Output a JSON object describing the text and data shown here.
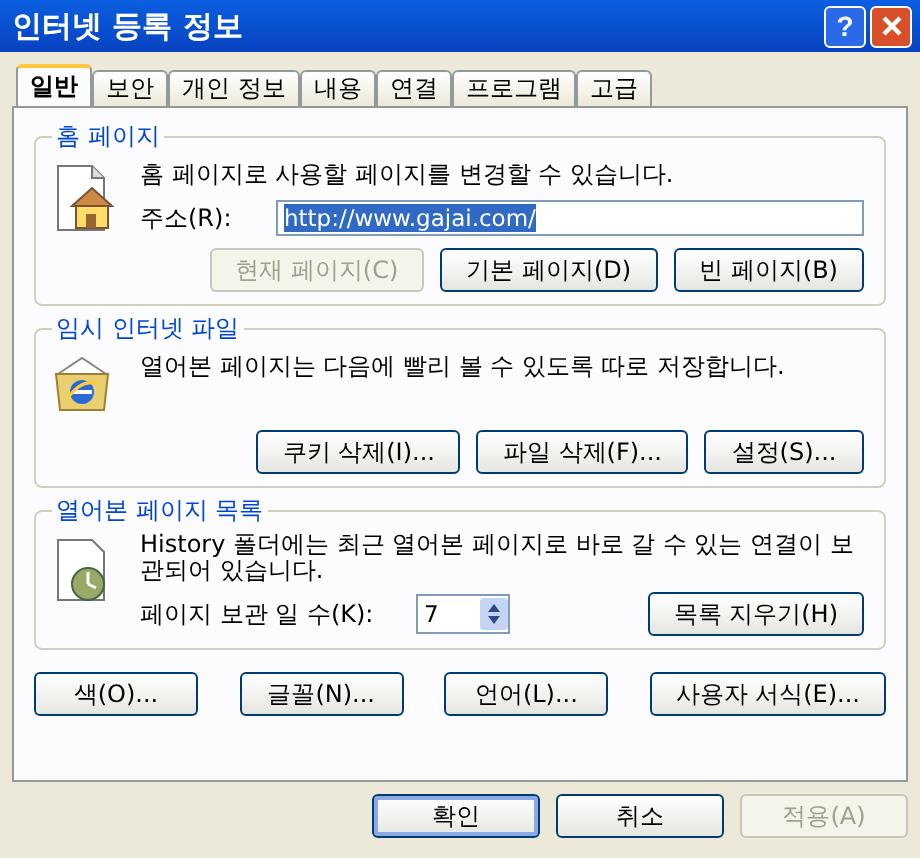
{
  "window": {
    "title": "인터넷 등록 정보",
    "help_glyph": "?"
  },
  "tabs": [
    {
      "label": "일반",
      "selected": true
    },
    {
      "label": "보안",
      "selected": false
    },
    {
      "label": "개인 정보",
      "selected": false
    },
    {
      "label": "내용",
      "selected": false
    },
    {
      "label": "연결",
      "selected": false
    },
    {
      "label": "프로그램",
      "selected": false
    },
    {
      "label": "고급",
      "selected": false
    }
  ],
  "home_page": {
    "title": "홈 페이지",
    "description": "홈 페이지로 사용할 페이지를 변경할 수 있습니다.",
    "address_label": "주소(R):",
    "address_value": "http://www.gajai.com/",
    "address_selected": true,
    "buttons": [
      {
        "label": "현재 페이지(C)",
        "disabled": true
      },
      {
        "label": "기본 페이지(D)",
        "disabled": false
      },
      {
        "label": "빈 페이지(B)",
        "disabled": false
      }
    ]
  },
  "temp_files": {
    "title": "임시 인터넷 파일",
    "description": "열어본 페이지는 다음에 빨리 볼 수 있도록 따로 저장합니다.",
    "buttons": [
      {
        "label": "쿠키 삭제(I)...",
        "disabled": false
      },
      {
        "label": "파일 삭제(F)...",
        "disabled": false
      },
      {
        "label": "설정(S)...",
        "disabled": false
      }
    ]
  },
  "history": {
    "title": "열어본 페이지 목록",
    "description": "History 폴더에는 최근 열어본 페이지로 바로 갈 수 있는 연결이 보관되어 있습니다.",
    "days_label": "페이지 보관 일 수(K):",
    "days_value": "7",
    "clear_button": {
      "label": "목록 지우기(H)",
      "disabled": false
    }
  },
  "bottom_buttons": [
    {
      "label": "색(O)...",
      "disabled": false
    },
    {
      "label": "글꼴(N)...",
      "disabled": false
    },
    {
      "label": "언어(L)...",
      "disabled": false
    },
    {
      "label": "사용자 서식(E)...",
      "disabled": false
    }
  ],
  "dialog_buttons": [
    {
      "label": "확인",
      "disabled": false,
      "default": true
    },
    {
      "label": "취소",
      "disabled": false,
      "default": false
    },
    {
      "label": "적용(A)",
      "disabled": true,
      "default": false
    }
  ]
}
